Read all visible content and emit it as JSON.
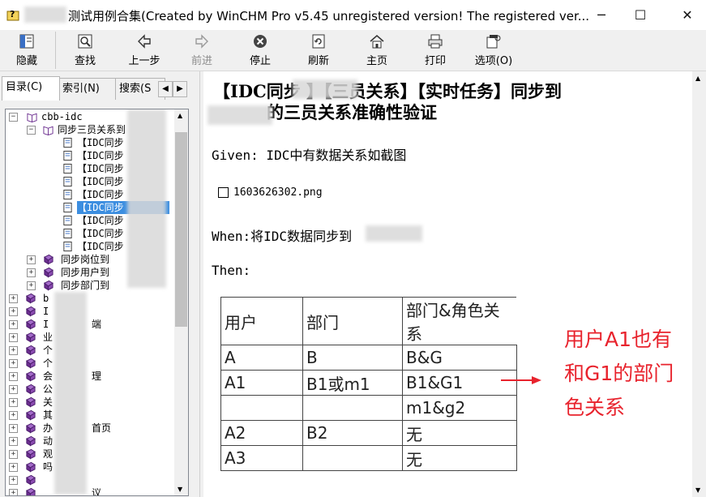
{
  "window": {
    "title": "测试用例合集(Created by WinCHM Pro v5.45 unregistered version! The registered ver...",
    "minimize": "─",
    "maximize": "☐",
    "close": "✕"
  },
  "toolbar": {
    "hide": "隐藏",
    "find": "查找",
    "back": "上一步",
    "forward": "前进",
    "stop": "停止",
    "refresh": "刷新",
    "home": "主页",
    "print": "打印",
    "options": "选项(O)"
  },
  "tabs": {
    "contents": "目录(C)",
    "index": "索引(N)",
    "search": "搜索(S"
  },
  "tree": {
    "root": "cbb-idc",
    "folder": "同步三员关系到",
    "pages": [
      "【IDC同步",
      "【IDC同步",
      "【IDC同步",
      "【IDC同步",
      "【IDC同步",
      "【IDC同步",
      "【IDC同步",
      "【IDC同步",
      "【IDC同步"
    ],
    "books_level2": [
      "同步岗位到",
      "同步用户到",
      "同步部门到"
    ],
    "books_level1": [
      "b",
      "I",
      "I",
      "业",
      "个",
      "个",
      "会",
      "公",
      "关",
      "其",
      "办",
      "动",
      "观",
      "吗",
      "",
      ""
    ],
    "books_level1_tail": [
      "",
      "",
      "端",
      "",
      "",
      "",
      "理",
      "",
      "",
      "",
      "首页",
      "",
      "",
      "",
      "",
      "议"
    ]
  },
  "content": {
    "heading_line1": "【IDC同步          】【三员关系】【实时任务】同步到",
    "heading_line2": "的三员关系准确性验证",
    "given": "Given: IDC中有数据关系如截图",
    "image_name": "1603626302.png",
    "when": "When:将IDC数据同步到",
    "then": "Then:",
    "table": {
      "headers": [
        "用户",
        "部门",
        "部门&角色关系"
      ],
      "rows": [
        [
          "A",
          "B",
          "B&G"
        ],
        [
          "A1",
          "B1或m1",
          "B1&G1"
        ],
        [
          "",
          "",
          "m1&g2"
        ],
        [
          "A2",
          "B2",
          "无"
        ],
        [
          "A3",
          "",
          "无"
        ]
      ]
    },
    "note_lines": [
      "用户A1也有",
      "和G1的部门",
      "色关系"
    ],
    "accent_color": "#e8232d"
  }
}
